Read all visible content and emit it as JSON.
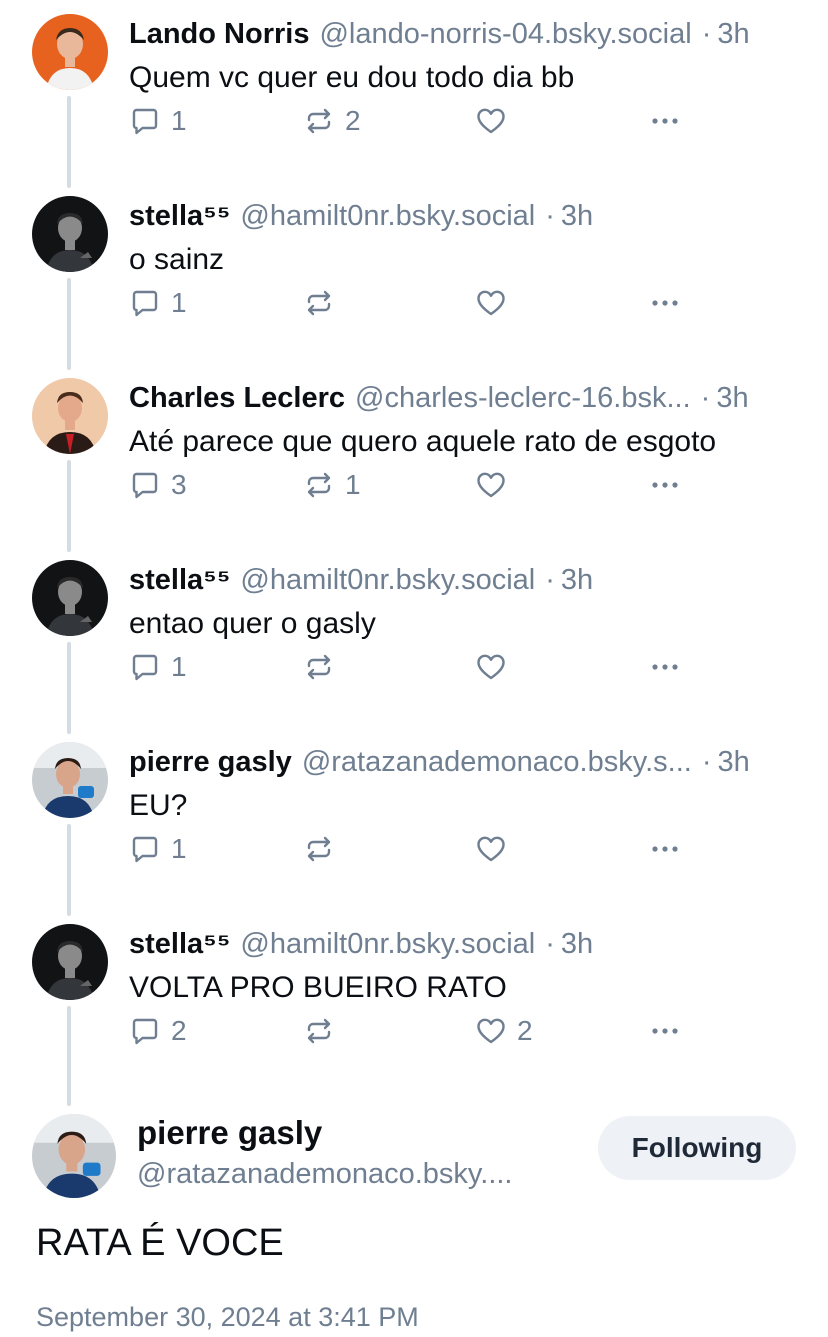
{
  "posts": [
    {
      "name": "Lando Norris",
      "handle": "@lando-norris-04.bsky.social",
      "time": "3h",
      "text": "Quem vc quer eu dou todo dia bb",
      "replies": "1",
      "reposts": "2",
      "likes": "",
      "avatar": "lando"
    },
    {
      "name": "stella⁵⁵",
      "handle": "@hamilt0nr.bsky.social",
      "time": "3h",
      "text": "o sainz",
      "replies": "1",
      "reposts": "",
      "likes": "",
      "avatar": "stella"
    },
    {
      "name": "Charles Leclerc",
      "handle": "@charles-leclerc-16.bsk...",
      "time": "3h",
      "text": "Até parece que quero aquele rato de esgoto",
      "replies": "3",
      "reposts": "1",
      "likes": "",
      "avatar": "charles"
    },
    {
      "name": "stella⁵⁵",
      "handle": "@hamilt0nr.bsky.social",
      "time": "3h",
      "text": "entao quer o gasly",
      "replies": "1",
      "reposts": "",
      "likes": "",
      "avatar": "stella"
    },
    {
      "name": "pierre gasly",
      "handle": "@ratazanademonaco.bsky.s...",
      "time": "3h",
      "text": "EU?",
      "replies": "1",
      "reposts": "",
      "likes": "",
      "avatar": "pierre"
    },
    {
      "name": "stella⁵⁵",
      "handle": "@hamilt0nr.bsky.social",
      "time": "3h",
      "text": "VOLTA PRO BUEIRO RATO",
      "replies": "2",
      "reposts": "",
      "likes": "2",
      "avatar": "stella"
    }
  ],
  "main_post": {
    "name": "pierre gasly",
    "handle": "@ratazanademonaco.bsky....",
    "follow_label": "Following",
    "text": "RATA É VOCE",
    "date": "September 30, 2024 at 3:41 PM"
  },
  "icons": {
    "reply": "reply-icon",
    "repost": "repost-icon",
    "like": "heart-icon",
    "more": "more-icon"
  },
  "colors": {
    "text": "#0b0f14",
    "muted": "#6f7f91",
    "thread_line": "#d4dbe2",
    "button_bg": "#eef1f5"
  }
}
